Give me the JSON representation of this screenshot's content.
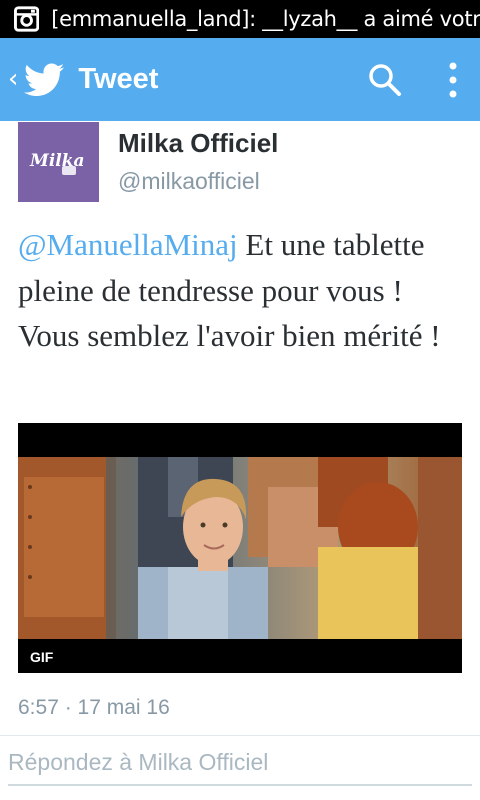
{
  "status_bar": {
    "icon": "instagram-icon",
    "notification": "[emmanuella_land]: __lyzah__ a aimé votre"
  },
  "action_bar": {
    "title": "Tweet",
    "background": "#55acee",
    "icons": [
      "back-chevron-icon",
      "twitter-bird-icon",
      "search-icon",
      "more-vert-icon"
    ]
  },
  "tweet": {
    "author_name": "Milka Officiel",
    "author_handle": "@milkaofficiel",
    "avatar_logo": "Milka",
    "mention": "@ManuellaMinaj",
    "text": " Et une tablette pleine de tendresse pour vous ! Vous semblez l'avoir bien mérité !",
    "media_badge": "GIF",
    "timestamp": "6:57 · 17 mai 16"
  },
  "reply": {
    "placeholder": "Répondez à Milka Officiel"
  }
}
